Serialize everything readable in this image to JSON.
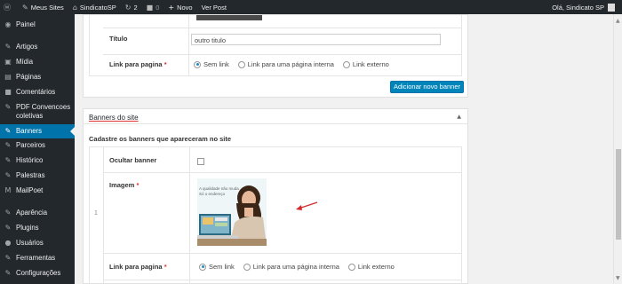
{
  "adminbar": {
    "site": "Meus Sites",
    "current_site": "SindicatoSP",
    "updates": "2",
    "comments": "0",
    "new_label": "Novo",
    "view_post": "Ver Post",
    "greeting": "Olá, Sindicato SP"
  },
  "sidebar": {
    "items": [
      {
        "icon": "dashboard-icon",
        "glyph": "◉",
        "label": "Painel"
      },
      {
        "icon": "pin-icon",
        "glyph": "✎",
        "label": "Artigos"
      },
      {
        "icon": "media-icon",
        "glyph": "▣",
        "label": "Mídia"
      },
      {
        "icon": "page-icon",
        "glyph": "▤",
        "label": "Páginas"
      },
      {
        "icon": "comment-icon",
        "glyph": "■",
        "label": "Comentários"
      },
      {
        "icon": "pin-icon",
        "glyph": "✎",
        "label": "PDF Convencoes coletivas"
      },
      {
        "icon": "pin-icon",
        "glyph": "✎",
        "label": "Banners"
      },
      {
        "icon": "pin-icon",
        "glyph": "✎",
        "label": "Parceiros"
      },
      {
        "icon": "pin-icon",
        "glyph": "✎",
        "label": "Histórico"
      },
      {
        "icon": "pin-icon",
        "glyph": "✎",
        "label": "Palestras"
      },
      {
        "icon": "mailpoet-icon",
        "glyph": "M",
        "label": "MailPoet"
      },
      {
        "icon": "appearance-icon",
        "glyph": "✎",
        "label": "Aparência"
      },
      {
        "icon": "plugin-icon",
        "glyph": "✎",
        "label": "Plugins"
      },
      {
        "icon": "users-icon",
        "glyph": "●",
        "label": "Usuários"
      },
      {
        "icon": "tools-icon",
        "glyph": "✎",
        "label": "Ferramentas"
      },
      {
        "icon": "settings-icon",
        "glyph": "✎",
        "label": "Configurações"
      }
    ],
    "active": "Banners"
  },
  "top_panel": {
    "titulo_label": "Título",
    "titulo_value": "outro titulo",
    "link_label": "Link para pagina",
    "required_mark": "*",
    "link_options": [
      "Sem link",
      "Link para uma página interna",
      "Link externo"
    ],
    "link_selected": "Sem link",
    "add_button": "Adicionar novo banner"
  },
  "banners_panel": {
    "title": "Banners do site",
    "description": "Cadastre os banners que apareceram no site",
    "row_number": "1",
    "ocultar_label": "Ocultar banner",
    "imagem_label": "Imagem",
    "required_mark": "*",
    "banner_text_line1": "A qualidade não muda",
    "banner_text_line2": "Só o endereço",
    "link_label": "Link para pagina",
    "link_options": [
      "Sem link",
      "Link para uma página interna",
      "Link externo"
    ],
    "link_selected": "Sem link"
  },
  "colors": {
    "admin_bar": "#23282d",
    "accent": "#0073aa",
    "button": "#0085ba",
    "required": "#dc3232",
    "arrow": "#d12b2b"
  }
}
